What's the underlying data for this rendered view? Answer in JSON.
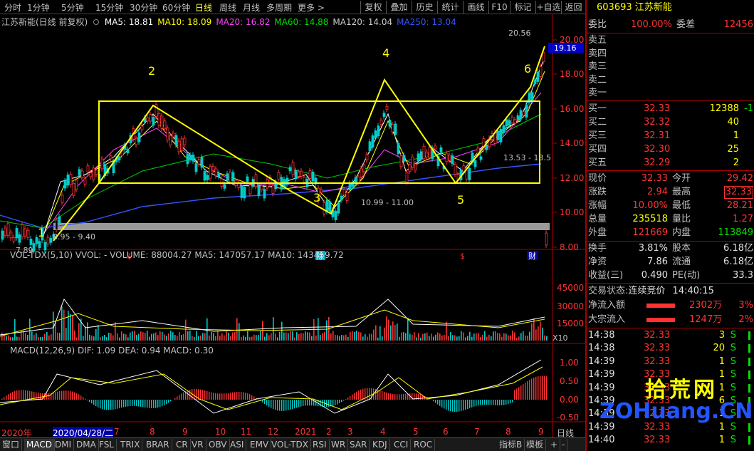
{
  "toolbar": {
    "periods": [
      "分时",
      "1分钟",
      "5分钟",
      "15分钟",
      "30分钟",
      "60分钟",
      "日线",
      "周线",
      "月线",
      "多周期",
      "更多 >"
    ],
    "active_period": "日线",
    "right_buttons": [
      "复权",
      "叠加",
      "历史",
      "统计",
      "画线",
      "F10",
      "标记",
      "+自选",
      "返回"
    ]
  },
  "chart": {
    "title": "江苏新能(日线 前复权)",
    "ma_labels": [
      {
        "text": "MA5: 18.81",
        "color": "#ffffff"
      },
      {
        "text": "MA10: 18.09",
        "color": "#ffff00"
      },
      {
        "text": "MA20: 16.82",
        "color": "#ff44ff"
      },
      {
        "text": "MA60: 14.88",
        "color": "#00dd00"
      },
      {
        "text": "MA120: 14.04",
        "color": "#cccccc"
      },
      {
        "text": "MA250: 13.04",
        "color": "#3355ff"
      }
    ],
    "price_axis": [
      "20.00",
      "18.00",
      "16.00",
      "14.00",
      "12.00",
      "10.00",
      "8.00"
    ],
    "high_label": "20.56",
    "current_price_tag": "19.16",
    "annotations": {
      "low_start": "7.89",
      "range1": "8.95 - 9.40",
      "range2": "10.99 - 11.00",
      "range3": "13.53 - 13.5",
      "points": [
        "1",
        "2",
        "3",
        "4",
        "5",
        "6"
      ]
    },
    "markers": [
      "$",
      "除",
      "$",
      "财"
    ],
    "x_dates": [
      "2020年",
      "2020/04/28/二",
      "7",
      "8",
      "9",
      "10",
      "11",
      "12",
      "2021",
      "2",
      "3",
      "4",
      "5",
      "6",
      "7",
      "8",
      "9"
    ],
    "period_label": "日线",
    "vol_title": "VOL-TDX(5,10)  VVOL: -   VOLUME: 88004.27  MA5: 147057.17  MA10: 143459.72",
    "vol_axis": [
      "45000",
      "30000",
      "15000"
    ],
    "vol_unit": "X10",
    "macd_title": "MACD(12,26,9)  DIF: 1.09  DEA: 0.94  MACD: 0.30",
    "macd_axis": [
      "1.00",
      "0.50",
      "0.00",
      "-0.50"
    ]
  },
  "indicators": [
    "窗口",
    "MACD",
    "DMI",
    "DMA",
    "FSL",
    "TRIX",
    "BRAR",
    "CR",
    "VR",
    "OBV",
    "ASI",
    "EMV",
    "VOL-TDX",
    "RSI",
    "WR",
    "SAR",
    "KDJ",
    "CCI",
    "ROC",
    "指标B",
    "模板",
    "+",
    "-"
  ],
  "quote": {
    "code": "603693",
    "name": "江苏新能",
    "weibi_label": "委比",
    "weibi": "100.00%",
    "weicha_label": "委差",
    "weicha": "12456",
    "sells": [
      "卖五",
      "卖四",
      "卖三",
      "卖二",
      "卖一"
    ],
    "buys": [
      {
        "label": "买一",
        "price": "32.33",
        "vol": "12388",
        "chg": "-1"
      },
      {
        "label": "买二",
        "price": "32.32",
        "vol": "40",
        "chg": ""
      },
      {
        "label": "买三",
        "price": "32.31",
        "vol": "1",
        "chg": ""
      },
      {
        "label": "买四",
        "price": "32.30",
        "vol": "25",
        "chg": ""
      },
      {
        "label": "买五",
        "price": "32.29",
        "vol": "2",
        "chg": ""
      }
    ],
    "stats": [
      {
        "l1": "现价",
        "v1": "32.33",
        "l2": "今开",
        "v2": "29.42"
      },
      {
        "l1": "涨跌",
        "v1": "2.94",
        "l2": "最高",
        "v2": "32.33"
      },
      {
        "l1": "涨幅",
        "v1": "10.00%",
        "l2": "最低",
        "v2": "28.21"
      },
      {
        "l1": "总量",
        "v1": "235518",
        "l2": "量比",
        "v2": "1.27"
      },
      {
        "l1": "外盘",
        "v1": "121669",
        "l2": "内盘",
        "v2": "113849"
      }
    ],
    "stats2": [
      {
        "l1": "换手",
        "v1": "3.81%",
        "l2": "股本",
        "v2": "6.18亿"
      },
      {
        "l1": "净资",
        "v1": "7.86",
        "l2": "流通",
        "v2": "6.18亿"
      },
      {
        "l1": "收益(三)",
        "v1": "0.490",
        "l2": "PE(动)",
        "v2": "33.3"
      }
    ],
    "trade_status_label": "交易状态:",
    "trade_status": "连续竞价",
    "trade_time": "14:40:15",
    "netflow_label": "净流入额",
    "netflow": "2302万",
    "netflow_pct": "3%",
    "bigflow_label": "大宗流入",
    "bigflow": "1247万",
    "bigflow_pct": "2%",
    "ticks": [
      {
        "t": "14:38",
        "p": "32.33",
        "v": "3",
        "s": "S"
      },
      {
        "t": "14:38",
        "p": "32.33",
        "v": "20",
        "s": "S"
      },
      {
        "t": "14:39",
        "p": "32.33",
        "v": "1",
        "s": "S"
      },
      {
        "t": "14:39",
        "p": "32.33",
        "v": "1",
        "s": "S"
      },
      {
        "t": "14:39",
        "p": "32.33",
        "v": "1",
        "s": "S"
      },
      {
        "t": "14:39",
        "p": "32.33",
        "v": "6",
        "s": "S"
      },
      {
        "t": "14:39",
        "p": "32.33",
        "v": "1",
        "s": "S"
      },
      {
        "t": "14:39",
        "p": "32.33",
        "v": "1",
        "s": "S"
      },
      {
        "t": "14:40",
        "p": "32.33",
        "v": "1",
        "s": "S"
      }
    ]
  },
  "watermark": {
    "line1": "拾荒网",
    "line2": "ZOHuang.CN"
  }
}
